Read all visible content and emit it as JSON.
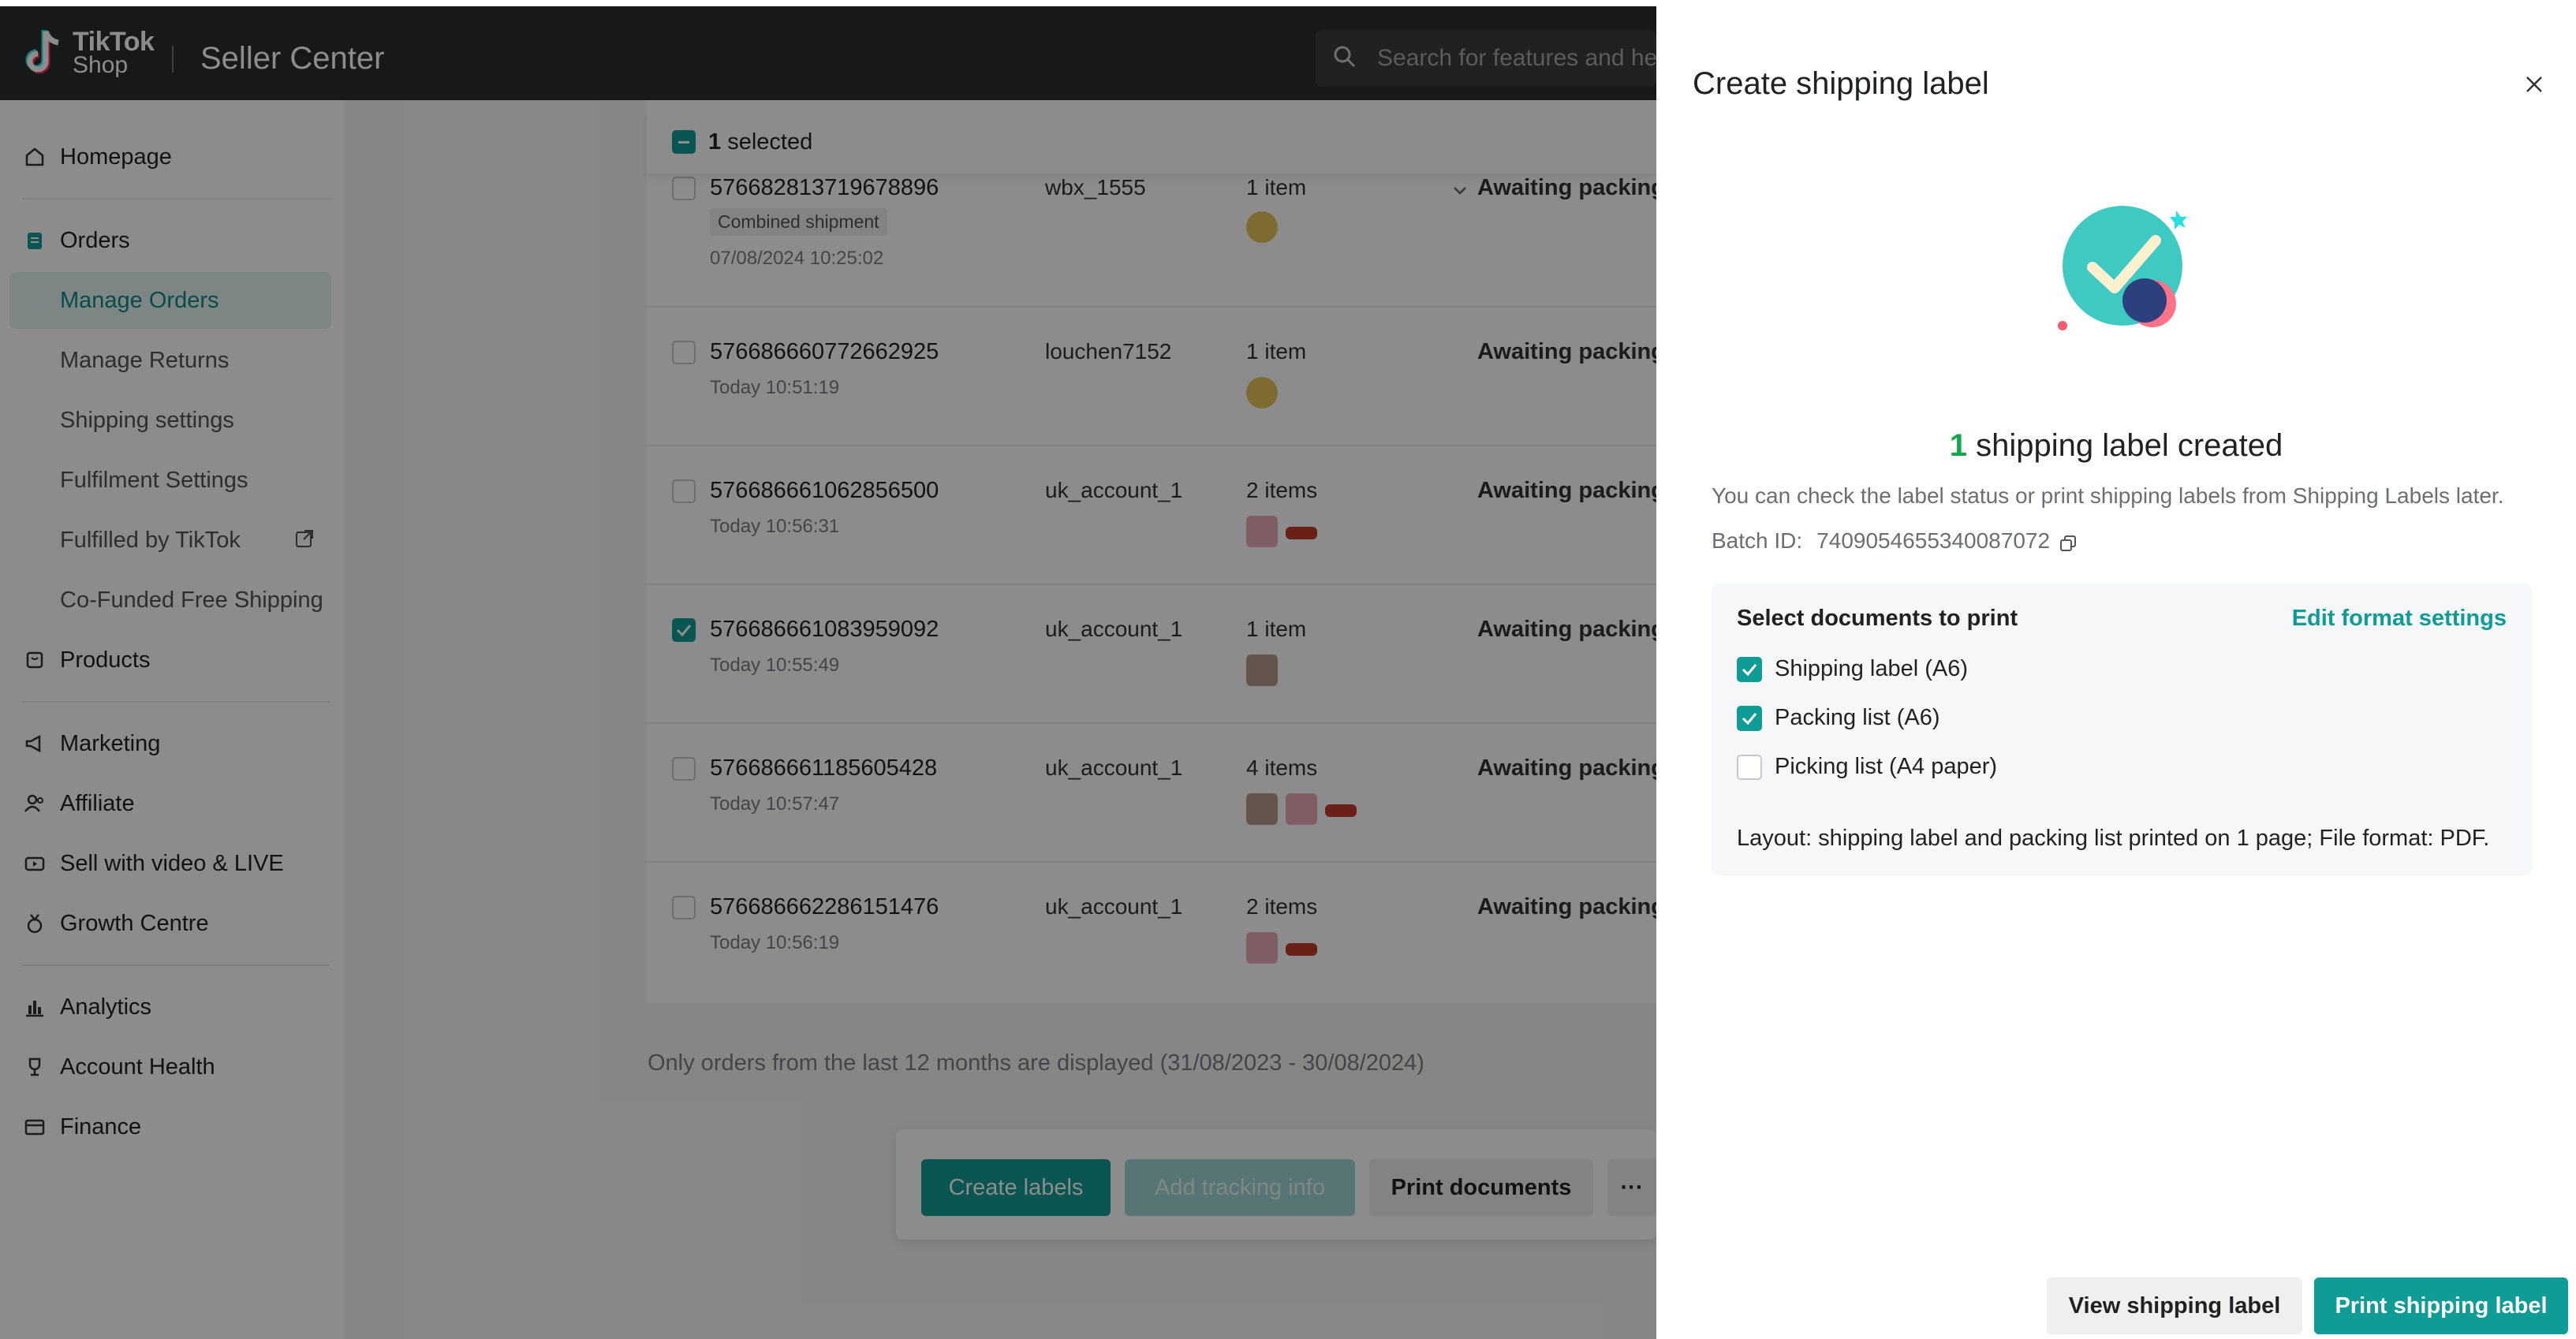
{
  "header": {
    "logo_line1": "TikTok",
    "logo_line2": "Shop",
    "app_title": "Seller Center",
    "search_placeholder": "Search for features and he"
  },
  "sidebar": {
    "homepage": "Homepage",
    "orders": "Orders",
    "orders_sub": [
      "Manage Orders",
      "Manage Returns",
      "Shipping settings",
      "Fulfilment Settings",
      "Fulfilled by TikTok",
      "Co-Funded Free Shipping"
    ],
    "products": "Products",
    "marketing": "Marketing",
    "affiliate": "Affiliate",
    "sell_video": "Sell with video & LIVE",
    "growth": "Growth Centre",
    "analytics": "Analytics",
    "account_health": "Account Health",
    "finance": "Finance"
  },
  "table": {
    "selected_count": "1",
    "selected_suffix": "selected",
    "rows": [
      {
        "order_id": "576682813719678896",
        "badge": "Combined shipment",
        "date": "07/08/2024 10:25:02",
        "buyer": "wbx_1555",
        "items": "1 item",
        "status": "Awaiting packing",
        "checked": false
      },
      {
        "order_id": "576686660772662925",
        "date": "Today 10:51:19",
        "buyer": "louchen7152",
        "items": "1 item",
        "status": "Awaiting packing",
        "checked": false
      },
      {
        "order_id": "576686661062856500",
        "date": "Today 10:56:31",
        "buyer": "uk_account_1",
        "items": "2 items",
        "status": "Awaiting packing",
        "checked": false
      },
      {
        "order_id": "576686661083959092",
        "date": "Today 10:55:49",
        "buyer": "uk_account_1",
        "items": "1 item",
        "status": "Awaiting packing",
        "checked": true
      },
      {
        "order_id": "576686661185605428",
        "date": "Today 10:57:47",
        "buyer": "uk_account_1",
        "items": "4 items",
        "status": "Awaiting packing",
        "checked": false
      },
      {
        "order_id": "576686662286151476",
        "date": "Today 10:56:19",
        "buyer": "uk_account_1",
        "items": "2 items",
        "status": "Awaiting packing",
        "checked": false
      }
    ],
    "note": "Only orders from the last 12 months are displayed (31/08/2023 - 30/08/2024)"
  },
  "actions": {
    "create_labels": "Create labels",
    "add_tracking": "Add tracking info",
    "print_documents": "Print documents",
    "more": "···"
  },
  "drawer": {
    "title": "Create shipping label",
    "headline_count": "1",
    "headline_text": "shipping label created",
    "subtext": "You can check the label status or print shipping labels from Shipping Labels later.",
    "batch_label": "Batch ID:",
    "batch_id": "7409054655340087072",
    "card_title": "Select documents to print",
    "edit_link": "Edit format settings",
    "options": [
      {
        "label": "Shipping label (A6)",
        "checked": true
      },
      {
        "label": "Packing list (A6)",
        "checked": true
      },
      {
        "label": "Picking list (A4 paper)",
        "checked": false
      }
    ],
    "layout_note": "Layout: shipping label and packing list printed on 1 page; File format: PDF.",
    "view_button": "View shipping label",
    "print_button": "Print shipping label"
  },
  "colors": {
    "accent": "#0f9b96",
    "success": "#14a64a",
    "topbar": "#2a2c2e"
  }
}
